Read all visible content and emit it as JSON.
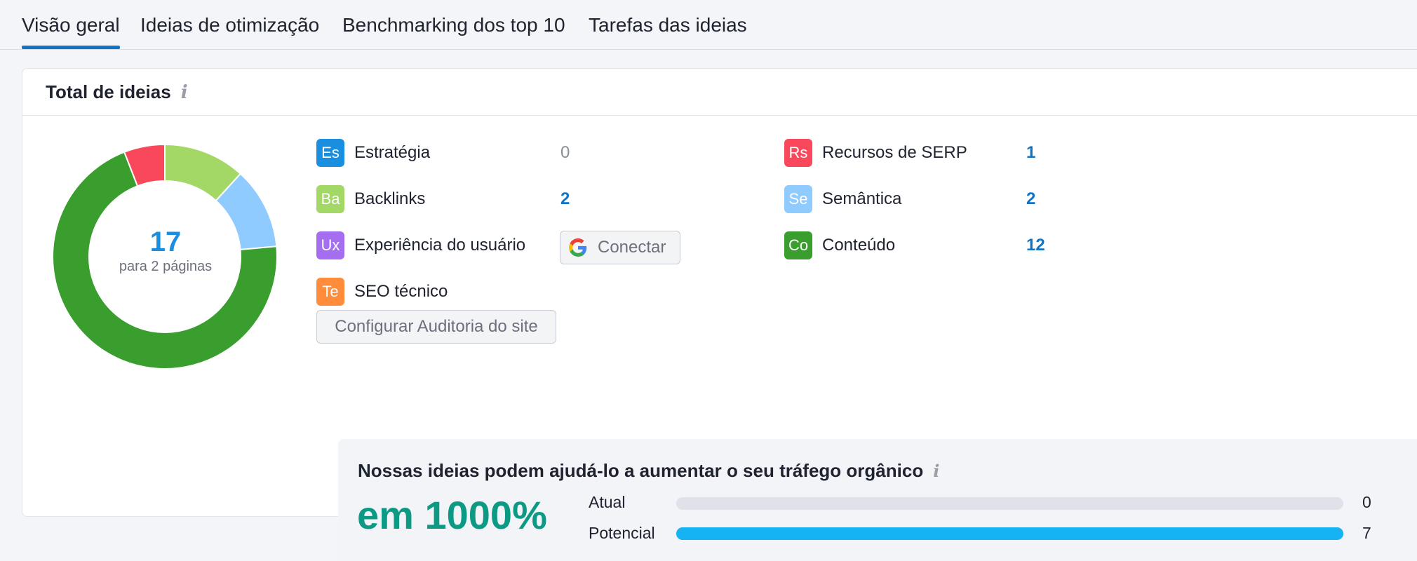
{
  "tabs": [
    {
      "label": "Visão geral",
      "active": true
    },
    {
      "label": "Ideias de otimização",
      "active": false
    },
    {
      "label": "Benchmarking dos top 10",
      "active": false
    },
    {
      "label": "Tarefas das ideias",
      "active": false
    }
  ],
  "card": {
    "title": "Total de ideias",
    "info_icon": "i"
  },
  "donut": {
    "total": "17",
    "subtitle": "para 2 páginas",
    "segments": [
      {
        "name": "Backlinks",
        "value": 2,
        "color": "#a3d866"
      },
      {
        "name": "Semântica",
        "value": 2,
        "color": "#8fcbff"
      },
      {
        "name": "Conteúdo",
        "value": 12,
        "color": "#3a9e2f"
      },
      {
        "name": "Recursos de SERP",
        "value": 1,
        "color": "#f9485b"
      }
    ]
  },
  "categories": {
    "estrategia": {
      "abbr": "Es",
      "label": "Estratégia",
      "value": "0",
      "color": "#1a8fe0"
    },
    "backlinks": {
      "abbr": "Ba",
      "label": "Backlinks",
      "value": "2",
      "color": "#a3d866"
    },
    "experiencia": {
      "abbr": "Ux",
      "label": "Experiência do usuário",
      "color": "#a56ef0"
    },
    "seo_tecnico": {
      "abbr": "Te",
      "label": "SEO técnico",
      "color": "#ff8c3b"
    },
    "recursos_serp": {
      "abbr": "Rs",
      "label": "Recursos de SERP",
      "value": "1",
      "color": "#f9485b"
    },
    "semantica": {
      "abbr": "Se",
      "label": "Semântica",
      "value": "2",
      "color": "#8fcbff"
    },
    "conteudo": {
      "abbr": "Co",
      "label": "Conteúdo",
      "value": "12",
      "color": "#3a9e2f"
    }
  },
  "buttons": {
    "connect_label": "Conectar",
    "connect_icon": "google-icon",
    "site_audit_label": "Configurar Auditoria do site"
  },
  "potential": {
    "title": "Nossas ideias podem ajudá-lo a aumentar o seu tráfego orgânico",
    "info_icon": "i",
    "headline": "em 1000%",
    "bars": [
      {
        "label": "Atual",
        "value": "0",
        "fill": 0
      },
      {
        "label": "Potencial",
        "value": "7",
        "fill": 1
      }
    ],
    "fill_color": "#16b3f2",
    "track_color": "#e0e2e9"
  }
}
